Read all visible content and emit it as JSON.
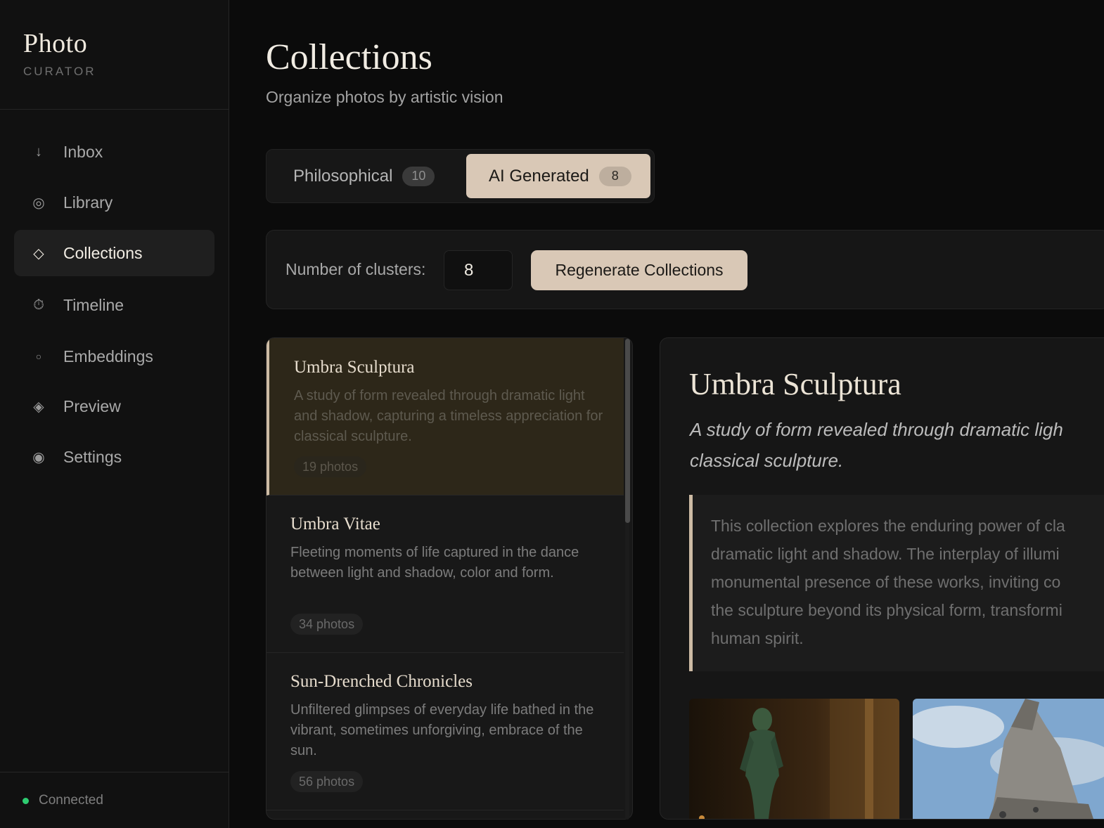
{
  "brand": {
    "title": "Photo",
    "subtitle": "CURATOR"
  },
  "nav": [
    {
      "label": "Inbox",
      "icon": "arrow-down-icon",
      "glyph": "↓",
      "active": false
    },
    {
      "label": "Library",
      "icon": "circle-ring-icon",
      "glyph": "◎",
      "active": false
    },
    {
      "label": "Collections",
      "icon": "diamond-icon",
      "glyph": "◇",
      "active": true
    },
    {
      "label": "Timeline",
      "icon": "stopwatch-icon",
      "glyph": "⏱",
      "active": false
    },
    {
      "label": "Embeddings",
      "icon": "small-circle-icon",
      "glyph": "○",
      "active": false
    },
    {
      "label": "Preview",
      "icon": "diamond-dot-icon",
      "glyph": "◈",
      "active": false
    },
    {
      "label": "Settings",
      "icon": "radio-dot-icon",
      "glyph": "◉",
      "active": false
    }
  ],
  "status": {
    "text": "Connected",
    "color": "#2ecc71"
  },
  "header": {
    "title": "Collections",
    "subtitle": "Organize photos by artistic vision"
  },
  "tabs": [
    {
      "label": "Philosophical",
      "count": "10",
      "active": false
    },
    {
      "label": "AI Generated",
      "count": "8",
      "active": true
    }
  ],
  "controls": {
    "clusters_label": "Number of clusters:",
    "clusters_value": "8",
    "regenerate_label": "Regenerate Collections"
  },
  "collections": [
    {
      "title": "Umbra Sculptura",
      "description": "A study of form revealed through dramatic light and shadow, capturing a timeless appreciation for classical sculpture.",
      "count": "19 photos",
      "active": true
    },
    {
      "title": "Umbra Vitae",
      "description": "Fleeting moments of life captured in the dance between light and shadow, color and form.",
      "count": "34 photos",
      "active": false
    },
    {
      "title": "Sun-Drenched Chronicles",
      "description": "Unfiltered glimpses of everyday life bathed in the vibrant, sometimes unforgiving, embrace of the sun.",
      "count": "56 photos",
      "active": false
    }
  ],
  "detail": {
    "title": "Umbra Sculptura",
    "tagline": "A study of form revealed through dramatic ligh classical sculpture.",
    "body_lines": [
      "This collection explores the enduring power of cla",
      "dramatic light and shadow. The interplay of illumi",
      "monumental presence of these works, inviting co",
      "the sculpture beyond its physical form, transformi",
      "human spirit."
    ]
  },
  "colors": {
    "accent": "#d9c8b6",
    "background": "#0b0b0b",
    "sidebar": "#111111"
  }
}
